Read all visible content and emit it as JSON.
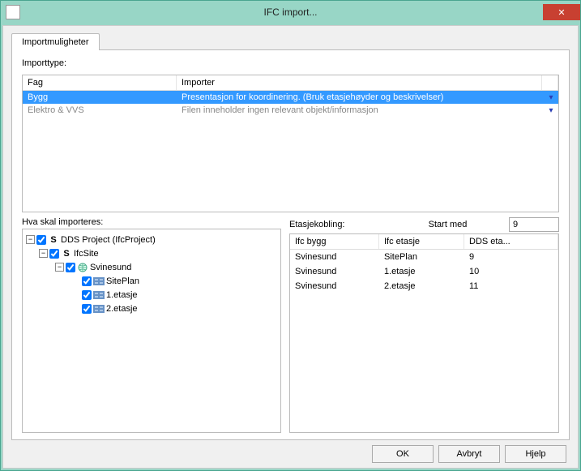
{
  "window": {
    "title": "IFC import..."
  },
  "tab_label": "Importmuligheter",
  "importtype": {
    "label": "Importtype:",
    "headers": {
      "fag": "Fag",
      "importer": "Importer"
    },
    "rows": [
      {
        "fag": "Bygg",
        "importer": "Presentasjon for koordinering. (Bruk etasjehøyder og beskrivelser)",
        "selected": true
      },
      {
        "fag": "Elektro & VVS",
        "importer": "Filen inneholder ingen relevant objekt/informasjon",
        "dim": true
      }
    ]
  },
  "tree": {
    "label": "Hva skal importeres:",
    "nodes": [
      {
        "level": 0,
        "expand": "-",
        "checked": true,
        "icon": "s",
        "label": "DDS Project (IfcProject)"
      },
      {
        "level": 1,
        "expand": "-",
        "checked": true,
        "icon": "s",
        "label": "IfcSite"
      },
      {
        "level": 2,
        "expand": "-",
        "checked": true,
        "icon": "globe",
        "label": "Svinesund"
      },
      {
        "level": 3,
        "expand": "",
        "checked": true,
        "icon": "floor",
        "label": "SitePlan"
      },
      {
        "level": 3,
        "expand": "",
        "checked": true,
        "icon": "floor",
        "label": "1.etasje"
      },
      {
        "level": 3,
        "expand": "",
        "checked": true,
        "icon": "floor",
        "label": "2.etasje"
      }
    ]
  },
  "kobling": {
    "label": "Etasjekobling:",
    "start_label": "Start med",
    "start_value": "9",
    "headers": {
      "bygg": "Ifc bygg",
      "etasje": "Ifc etasje",
      "dds": "DDS eta..."
    },
    "rows": [
      {
        "bygg": "Svinesund",
        "etasje": "SitePlan",
        "dds": "9"
      },
      {
        "bygg": "Svinesund",
        "etasje": "1.etasje",
        "dds": "10"
      },
      {
        "bygg": "Svinesund",
        "etasje": "2.etasje",
        "dds": "11"
      }
    ]
  },
  "buttons": {
    "ok": "OK",
    "cancel": "Avbryt",
    "help": "Hjelp"
  }
}
